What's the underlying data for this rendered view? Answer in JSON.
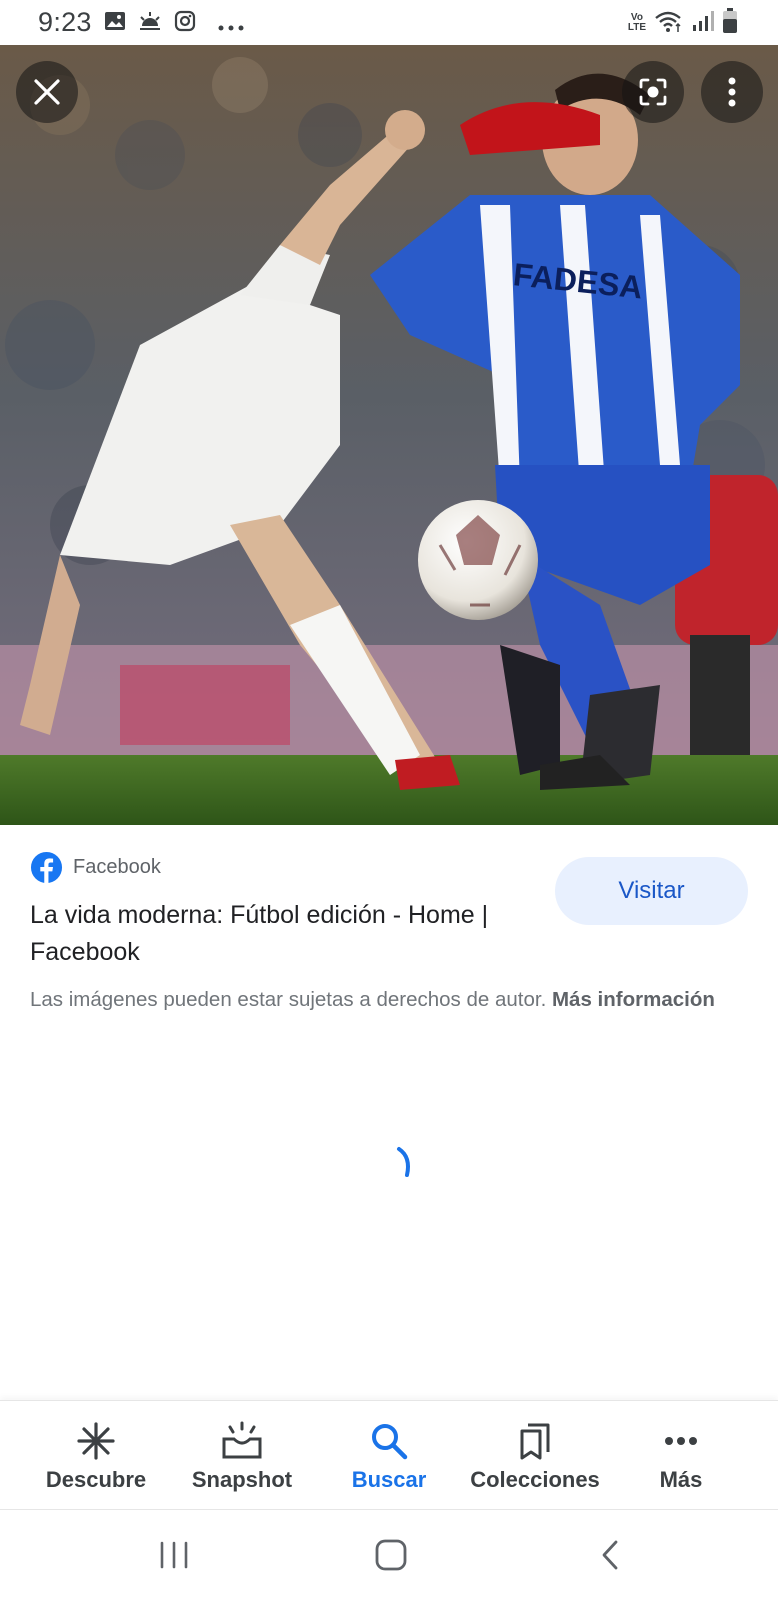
{
  "status_bar": {
    "time": "9:23",
    "network_label_top": "Vo",
    "network_label_bottom": "LTE",
    "icons": [
      "gallery-icon",
      "weather-icon",
      "instagram-icon",
      "more-dots-icon",
      "wifi-icon",
      "signal-icon",
      "battery-icon"
    ]
  },
  "viewer": {
    "image_alt": "Foto de fútbol",
    "close_icon": "close-icon",
    "lens_icon": "lens-icon",
    "menu_icon": "more-vert-icon",
    "jersey_text": "FADESA"
  },
  "result": {
    "source_name": "Facebook",
    "title": "La vida moderna: Fútbol edición - Home | Facebook",
    "visit_label": "Visitar",
    "copyright_text": "Las imágenes pueden estar sujetas a derechos de autor.",
    "more_info_label": "Más información"
  },
  "bottom_nav": {
    "items": [
      {
        "label": "Descubre",
        "icon": "asterisk-icon"
      },
      {
        "label": "Snapshot",
        "icon": "snapshot-icon"
      },
      {
        "label": "Buscar",
        "icon": "search-icon"
      },
      {
        "label": "Colecciones",
        "icon": "collections-icon"
      },
      {
        "label": "Más",
        "icon": "more-horiz-icon"
      }
    ],
    "active": "Buscar"
  },
  "system_nav": {
    "buttons": [
      "recent-apps-icon",
      "home-icon",
      "back-icon"
    ]
  },
  "colors": {
    "accent": "#1a73e8",
    "visit_bg": "#e8f0fe",
    "jersey_blue": "#1f4fbf",
    "grass": "#3f6a22"
  }
}
